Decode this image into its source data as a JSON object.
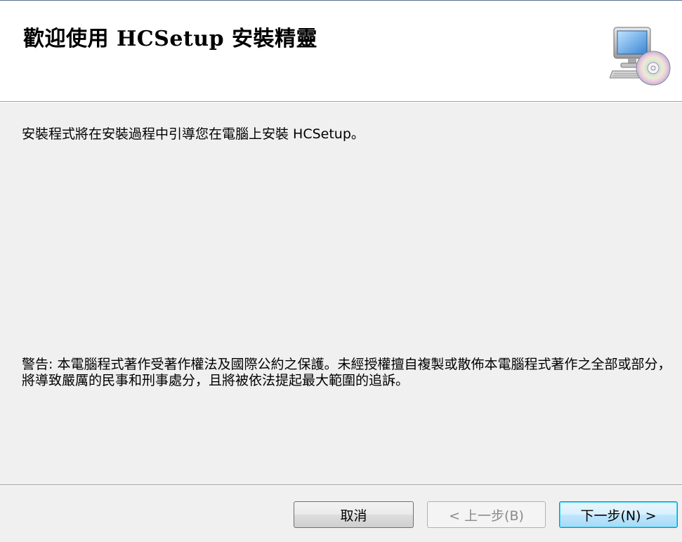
{
  "header": {
    "title": "歡迎使用 HCSetup 安裝精靈",
    "icon": "computer-cd-icon"
  },
  "body": {
    "intro": "安裝程式將在安裝過程中引導您在電腦上安裝 HCSetup。",
    "warning": "警告: 本電腦程式著作受著作權法及國際公約之保護。未經授權擅自複製或散佈本電腦程式著作之全部或部分，將導致嚴厲的民事和刑事處分，且將被依法提起最大範圍的追訴。"
  },
  "buttons": {
    "cancel": "取消",
    "back": "< 上一步(B)",
    "next": "下一步(N) >"
  },
  "colors": {
    "header_bg": "#ffffff",
    "body_bg": "#f0f0f0",
    "default_button_border": "#3c7fb1"
  }
}
